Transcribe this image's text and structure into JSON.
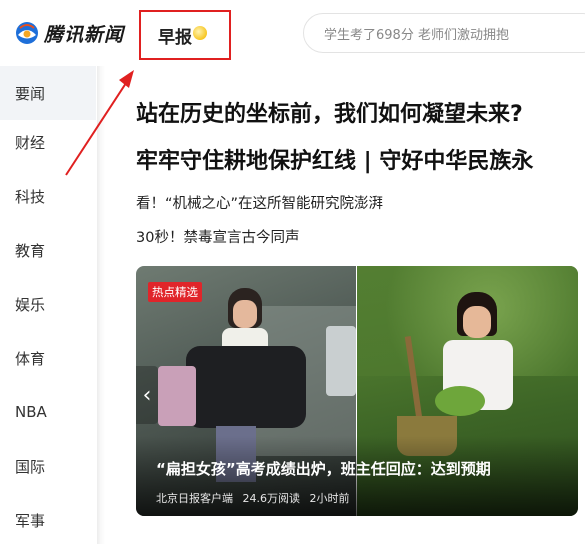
{
  "header": {
    "logo_text": "腾讯新闻",
    "zaobao_label": "早报",
    "search_placeholder": "学生考了698分 老师们激动拥抱"
  },
  "sidebar": {
    "items": [
      {
        "label": "要闻",
        "active": true
      },
      {
        "label": "财经",
        "active": false
      },
      {
        "label": "科技",
        "active": false
      },
      {
        "label": "教育",
        "active": false
      },
      {
        "label": "娱乐",
        "active": false
      },
      {
        "label": "体育",
        "active": false
      },
      {
        "label": "NBA",
        "active": false
      },
      {
        "label": "国际",
        "active": false
      },
      {
        "label": "军事",
        "active": false
      }
    ]
  },
  "main": {
    "headlines": [
      "站在历史的坐标前，我们如何凝望未来?",
      "牢牢守住耕地保护红线 | 守好中华民族永"
    ],
    "sublines": [
      "看！“机械之心”在这所智能研究院澎湃",
      "30秒！禁毒宣言古今同声"
    ],
    "feature": {
      "badge": "热点精选",
      "title": "“扁担女孩”高考成绩出炉，班主任回应：达到预期",
      "source": "北京日报客户端",
      "reads": "24.6万阅读",
      "time": "2小时前",
      "prev_icon": "chevron-left-icon"
    }
  },
  "colors": {
    "highlight_box": "#e02020",
    "badge_bg": "#e0252a",
    "sidebar_active_bg": "#f2f4f7"
  }
}
